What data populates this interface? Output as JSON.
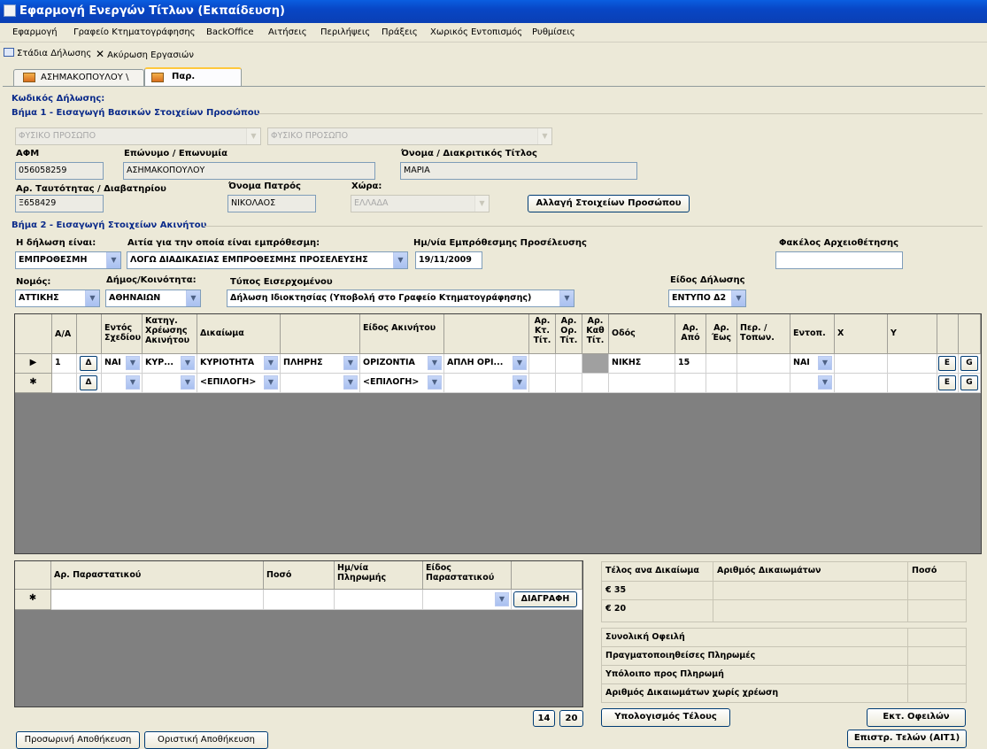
{
  "window": {
    "title": "Εφαρμογή Ενεργών Τίτλων (Εκπαίδευση)"
  },
  "menu": [
    "Εφαρμογή",
    "Γραφείο Κτηματογράφησης",
    "BackOffice",
    "Αιτήσεις",
    "Περιλήψεις",
    "Πράξεις",
    "Χωρικός Εντοπισμός",
    "Ρυθμίσεις"
  ],
  "toolbar": {
    "stages": "Στάδια Δήλωσης",
    "cancel": "Ακύρωση Εργασιών"
  },
  "tabs": [
    "ΑΣΗΜΑΚΟΠΟΥΛΟΥ \\",
    "Παρ. Δήλωσης"
  ],
  "code_label": "Κωδικός Δήλωσης:",
  "step1": {
    "title": "Βήμα 1 - Εισαγωγή Βασικών Στοιχείων Προσώπου",
    "person_type_1": "ΦΥΣΙΚΟ ΠΡΟΣΩΠΟ",
    "person_type_2": "ΦΥΣΙΚΟ ΠΡΟΣΩΠΟ",
    "afm_label": "ΑΦΜ",
    "afm": "056058259",
    "surname_label": "Επώνυμο / Επωνυμία",
    "surname": "ΑΣΗΜΑΚΟΠΟΥΛΟΥ",
    "name_label": "Όνομα / Διακριτικός Τίτλος",
    "name": "ΜΑΡΙΑ",
    "id_label": "Αρ. Ταυτότητας / Διαβατηρίου",
    "id": "Ξ658429",
    "father_label": "Όνομα Πατρός",
    "father": "ΝΙΚΟΛΑΟΣ",
    "country_label": "Χώρα:",
    "country": "ΕΛΛΑΔΑ",
    "change_btn": "Αλλαγή Στοιχείων Προσώπου"
  },
  "step2": {
    "title": "Βήμα 2 - Εισαγωγή Στοιχείων Ακινήτου",
    "decl_is_label": "Η δήλωση είναι:",
    "decl_is": "ΕΜΠΡΟΘΕΣΜΗ",
    "reason_label": "Αιτία για την οποία είναι εμπρόθεσμη:",
    "reason": "ΛΟΓΩ ΔΙΑΔΙΚΑΣΙΑΣ ΕΜΠΡΟΘΕΣΜΗΣ ΠΡΟΣΕΛΕΥΣΗΣ",
    "date_label": "Ημ/νία Εμπρόθεσμης Προσέλευσης",
    "date": "19/11/2009",
    "folder_label": "Φακέλος Αρχειοθέτησης",
    "folder": "",
    "prefecture_label": "Νομός:",
    "prefecture": "ΑΤΤΙΚΗΣ",
    "municipality_label": "Δήμος/Κοινότητα:",
    "municipality": "ΑΘΗΝΑΙΩΝ",
    "incoming_label": "Τύπος Εισερχομένου",
    "incoming": "Δήλωση Ιδιοκτησίας  (Υποβολή στο Γραφείο Κτηματογράφησης)",
    "decl_type_label": "Είδος Δήλωσης",
    "decl_type": "ΕΝΤΥΠΟ Δ2"
  },
  "grid": {
    "headers": [
      "Α/Α",
      "Εντός Σχεδίου",
      "Κατηγ. Χρέωσης Ακινήτου",
      "Δικαίωμα",
      "",
      "Είδος Ακινήτου",
      "",
      "Αρ. Κτ. Τίτ.",
      "Αρ. Ορ. Τίτ.",
      "Αρ. Καθ Τίτ.",
      "Οδός",
      "Αρ. Από",
      "Αρ. Έως",
      "Περ. / Τοπων.",
      "Εντοπ.",
      "X",
      "Y"
    ],
    "row1": {
      "aa": "1",
      "in_plan": "ΝΑΙ",
      "category": "ΚΥΡ...",
      "right": "ΚΥΡΙΟΤΗΤΑ",
      "right2": "ΠΛΗΡΗΣ",
      "type": "ΟΡΙΖΟΝΤΙΑ",
      "type2": "ΑΠΛΗ ΟΡΙ...",
      "street": "ΝΙΚΗΣ",
      "from": "15",
      "locate": "ΝΑΙ"
    },
    "row2": {
      "right": "<ΕΠΙΛΟΓΗ>",
      "type": "<ΕΠΙΛΟΓΗ>"
    },
    "delta": "Δ",
    "e": "E",
    "g": "G"
  },
  "payments": {
    "headers": [
      "Αρ. Παραστατικού",
      "Ποσό",
      "Ημ/νία Πληρωμής",
      "Είδος Παραστατικού"
    ],
    "delete_btn": "ΔΙΑΓΡΑΦΗ"
  },
  "fees": {
    "headers": [
      "Τέλος ανα Δικαίωμα",
      "Αριθμός Δικαιωμάτων",
      "Ποσό"
    ],
    "rows": [
      "€ 35",
      "€ 20"
    ],
    "summary": [
      "Συνολική Οφειλή",
      "Πραγματοποιηθείσες Πληρωμές",
      "Υπόλοιπο προς Πληρωμή",
      "Αριθμός Δικαιωμάτων χωρίς χρέωση"
    ]
  },
  "buttons": {
    "n14": "14",
    "n20": "20",
    "calc": "Υπολογισμός Τέλους",
    "print": "Εκτ. Οφειλών",
    "refund": "Επιστρ. Τελών (ΑΙΤ1)",
    "temp_save": "Προσωρινή Αποθήκευση",
    "final_save": "Οριστική Αποθήκευση"
  }
}
